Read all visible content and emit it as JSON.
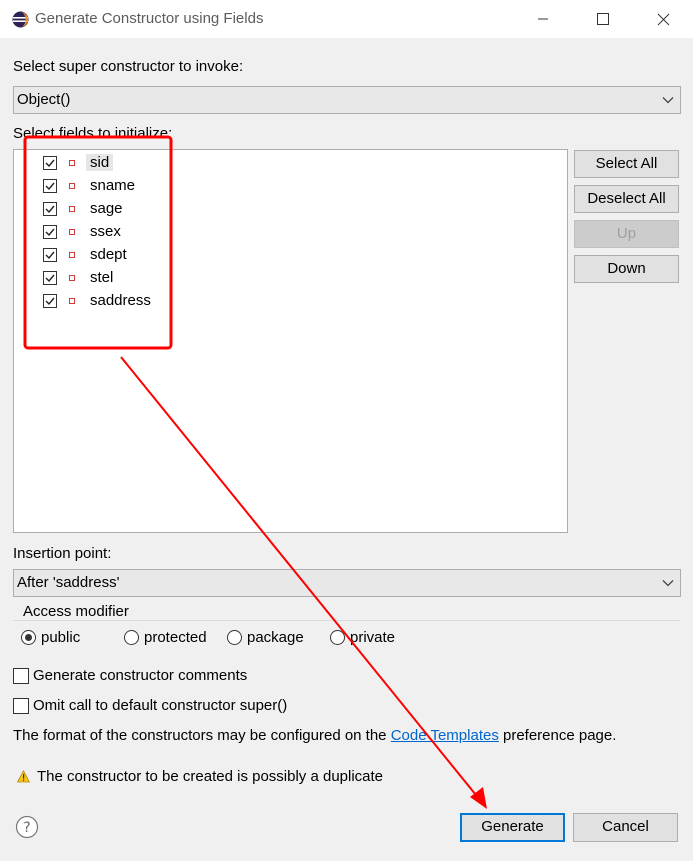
{
  "window": {
    "title": "Generate Constructor using Fields",
    "minimize_icon": "minimize-icon",
    "maximize_icon": "maximize-icon",
    "close_icon": "close-icon"
  },
  "super_constructor": {
    "label": "Select super constructor to invoke:",
    "value": "Object()"
  },
  "fields": {
    "label": "Select fields to initialize:",
    "items": [
      {
        "name": "sid",
        "checked": true,
        "selected": true
      },
      {
        "name": "sname",
        "checked": true
      },
      {
        "name": "sage",
        "checked": true
      },
      {
        "name": "ssex",
        "checked": true
      },
      {
        "name": "sdept",
        "checked": true
      },
      {
        "name": "stel",
        "checked": true
      },
      {
        "name": "saddress",
        "checked": true
      }
    ]
  },
  "side_buttons": {
    "select_all": "Select All",
    "deselect_all": "Deselect All",
    "up": "Up",
    "down": "Down"
  },
  "insertion_point": {
    "label": "Insertion point:",
    "value": "After 'saddress'"
  },
  "access_modifier": {
    "legend": "Access modifier",
    "options": [
      "public",
      "protected",
      "package",
      "private"
    ],
    "selected": "public"
  },
  "options": {
    "generate_comments": "Generate constructor comments",
    "omit_super": "Omit call to default constructor super()"
  },
  "info": {
    "prefix": "The format of the constructors may be configured on the ",
    "link": "Code Templates",
    "suffix": " preference page."
  },
  "warning": {
    "text": "The constructor to be created is possibly a duplicate"
  },
  "footer": {
    "generate": "Generate",
    "cancel": "Cancel"
  },
  "annotation_color": "#ff0000",
  "accent_color": "#0078d7"
}
